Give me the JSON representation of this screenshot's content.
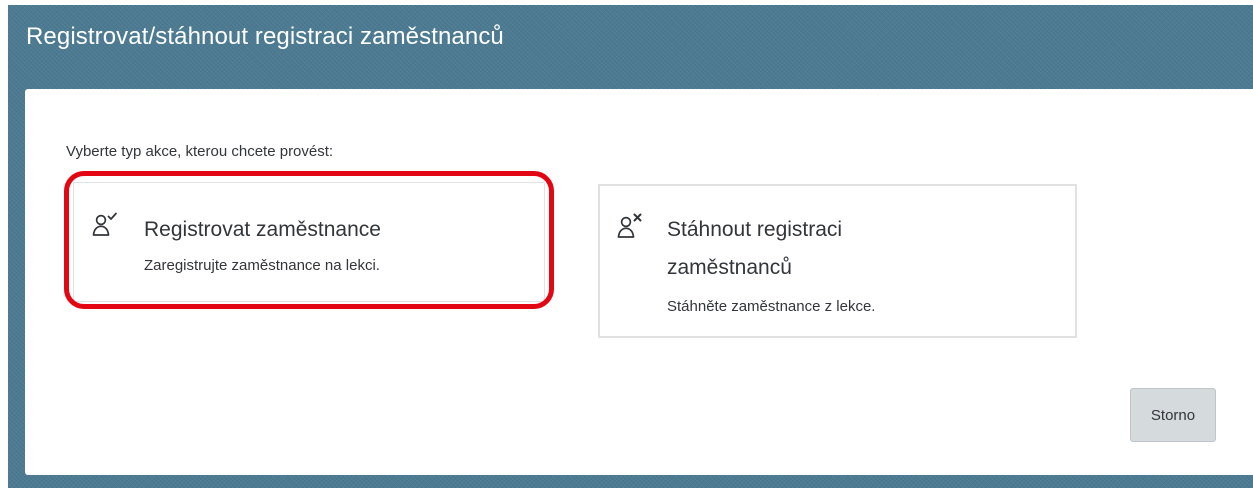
{
  "dialog": {
    "title": "Registrovat/stáhnout registraci zaměstnanců",
    "prompt": "Vyberte typ akce, kterou chcete provést:",
    "options": [
      {
        "icon": "person-check-icon",
        "title": "Registrovat zaměstnance",
        "description": "Zaregistrujte zaměstnance na lekci.",
        "highlighted": true
      },
      {
        "icon": "person-remove-icon",
        "title": "Stáhnout registraci zaměstnanců",
        "description": "Stáhněte zaměstnance z lekce.",
        "highlighted": false
      }
    ],
    "cancel_label": "Storno"
  },
  "colors": {
    "header_background": "#4b7a91",
    "highlight": "#e30613",
    "text": "#32363a",
    "button_background": "#d5dadd"
  }
}
